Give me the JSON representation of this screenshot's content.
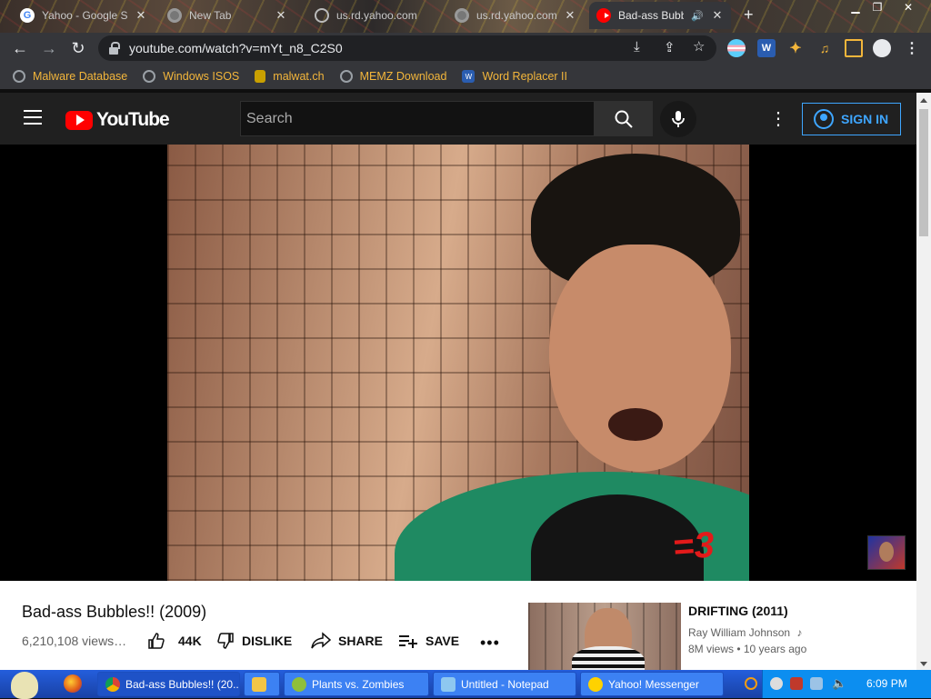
{
  "browser": {
    "tabs": [
      {
        "title": "Yahoo - Google Se",
        "icon": "google-icon",
        "active": false
      },
      {
        "title": "New Tab",
        "icon": "chrome-icon",
        "active": false
      },
      {
        "title": "us.rd.yahoo.com",
        "icon": "globe-icon",
        "active": false
      },
      {
        "title": "us.rd.yahoo.com",
        "icon": "chrome-icon",
        "active": false
      },
      {
        "title": "Bad-ass Bubb",
        "icon": "youtube-icon",
        "active": true
      }
    ],
    "tab_close_glyph": "✕",
    "new_tab_glyph": "+",
    "url": "youtube.com/watch?v=mYt_n8_C2S0",
    "bookmarks": [
      {
        "label": "Malware Database",
        "icon": "globe-icon"
      },
      {
        "label": "Windows ISOS",
        "icon": "globe-icon"
      },
      {
        "label": "malwat.ch",
        "icon": "bug-icon"
      },
      {
        "label": "MEMZ Download",
        "icon": "globe-icon"
      },
      {
        "label": "Word Replacer II",
        "icon": "word-replacer-icon"
      }
    ]
  },
  "youtube": {
    "logo_text": "YouTube",
    "search_placeholder": "Search",
    "sign_in_label": "SIGN IN",
    "video": {
      "title": "Bad-ass Bubbles!! (2009)",
      "views": "6,210,108 views…",
      "overlay_text": "=3",
      "likes": "44K",
      "dislike_label": "DISLIKE",
      "share_label": "SHARE",
      "save_label": "SAVE",
      "more_glyph": "•••"
    },
    "recommended": {
      "title": "DRIFTING (2011)",
      "channel": "Ray William Johnson",
      "channel_badge": "♪",
      "meta": "8M views • 10 years ago"
    }
  },
  "taskbar": {
    "tasks": [
      {
        "label": "Bad-ass Bubbles!! (20...",
        "icon": "chrome-icon",
        "active": true
      },
      {
        "label": "",
        "icon": "folder-icon",
        "active": false
      },
      {
        "label": "Plants vs. Zombies",
        "icon": "pvz-icon",
        "active": false
      },
      {
        "label": "Untitled - Notepad",
        "icon": "notepad-icon",
        "active": false
      },
      {
        "label": "Yahoo! Messenger",
        "icon": "yahoo-messenger-icon",
        "active": false
      }
    ],
    "clock": "6:09 PM"
  },
  "colors": {
    "youtube_red": "#ff0000",
    "link_blue": "#3ea6ff",
    "bookmark_text": "#f3b63b",
    "taskbar_blue": "#245edc"
  }
}
